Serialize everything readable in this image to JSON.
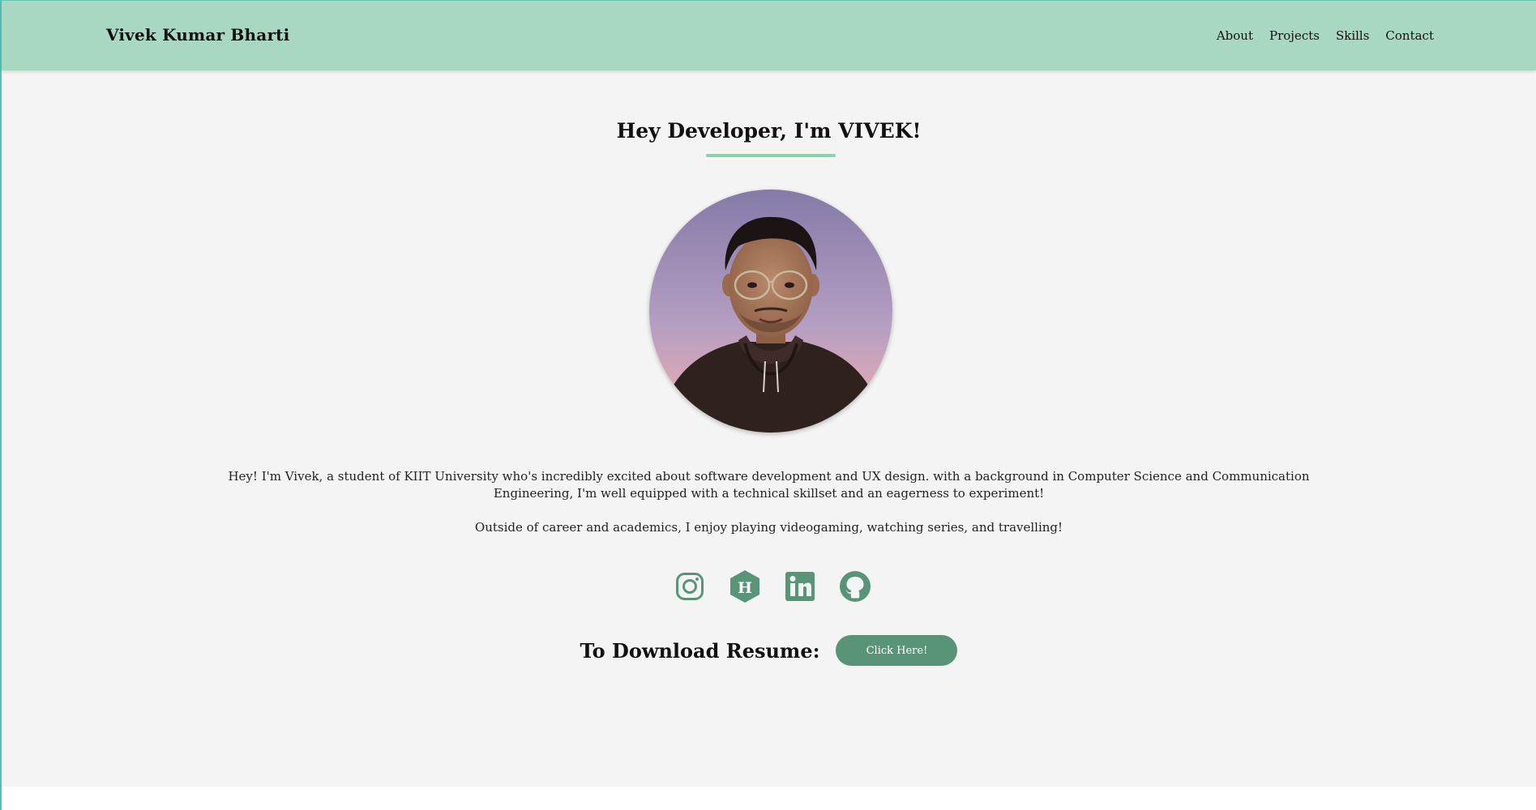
{
  "header": {
    "brand": "Vivek Kumar Bharti",
    "nav": [
      "About",
      "Projects",
      "Skills",
      "Contact"
    ]
  },
  "hero": {
    "title": "Hey Developer, I'm VIVEK!",
    "bio_1": "Hey! I'm Vivek, a student of KIIT University who's incredibly excited about software development and UX design. with a background in Computer Science and Communication Engineering, I'm well equipped with a technical skillset and an eagerness to experiment!",
    "bio_2": "Outside of career and academics, I enjoy playing videogaming, watching series, and travelling!"
  },
  "socials": [
    {
      "icon": "instagram-icon"
    },
    {
      "icon": "hashnode-icon"
    },
    {
      "icon": "linkedin-icon"
    },
    {
      "icon": "github-icon"
    }
  ],
  "resume": {
    "label": "To Download Resume:",
    "button": "Click Here!"
  },
  "colors": {
    "header_bg": "#a8d8c1",
    "accent": "#5a9478",
    "page_bg": "#f4f4f4",
    "underline": "#8fcfb2"
  }
}
